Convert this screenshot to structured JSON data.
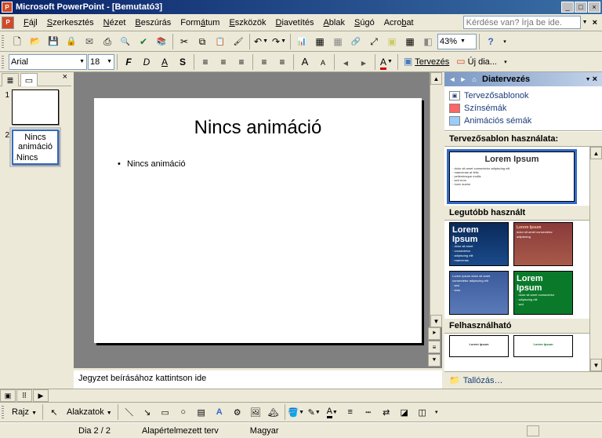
{
  "title": "Microsoft PowerPoint - [Bemutató3]",
  "menubar": [
    "Fájl",
    "Szerkesztés",
    "Nézet",
    "Beszúrás",
    "Formátum",
    "Eszközök",
    "Diavetítés",
    "Ablak",
    "Súgó",
    "Acrobat"
  ],
  "help_box_placeholder": "Kérdése van? Írja be ide.",
  "zoom": "43%",
  "format_toolbar": {
    "font": "Arial",
    "size": "18",
    "design_label": "Tervezés",
    "new_slide_label": "Új dia..."
  },
  "slides": [
    {
      "num": "1",
      "preview": ""
    },
    {
      "num": "2",
      "preview": "Nincs animáció"
    }
  ],
  "selected_slide_index": 1,
  "current_slide": {
    "title": "Nincs animáció",
    "bullets": [
      "Nincs animáció"
    ]
  },
  "notes_placeholder": "Jegyzet beírásához kattintson ide",
  "taskpane": {
    "title": "Diatervezés",
    "links": [
      "Tervezősablonok",
      "Színsémák",
      "Animációs sémák"
    ],
    "section1": "Tervezősablon használata:",
    "section2": "Legutóbb használt",
    "section3": "Felhasználható",
    "browse": "Tallózás…"
  },
  "drawbar": {
    "draw_label": "Rajz",
    "shapes_label": "Alakzatok"
  },
  "statusbar": {
    "slide_pos": "Dia 2 / 2",
    "design": "Alapértelmezett terv",
    "lang": "Magyar"
  }
}
